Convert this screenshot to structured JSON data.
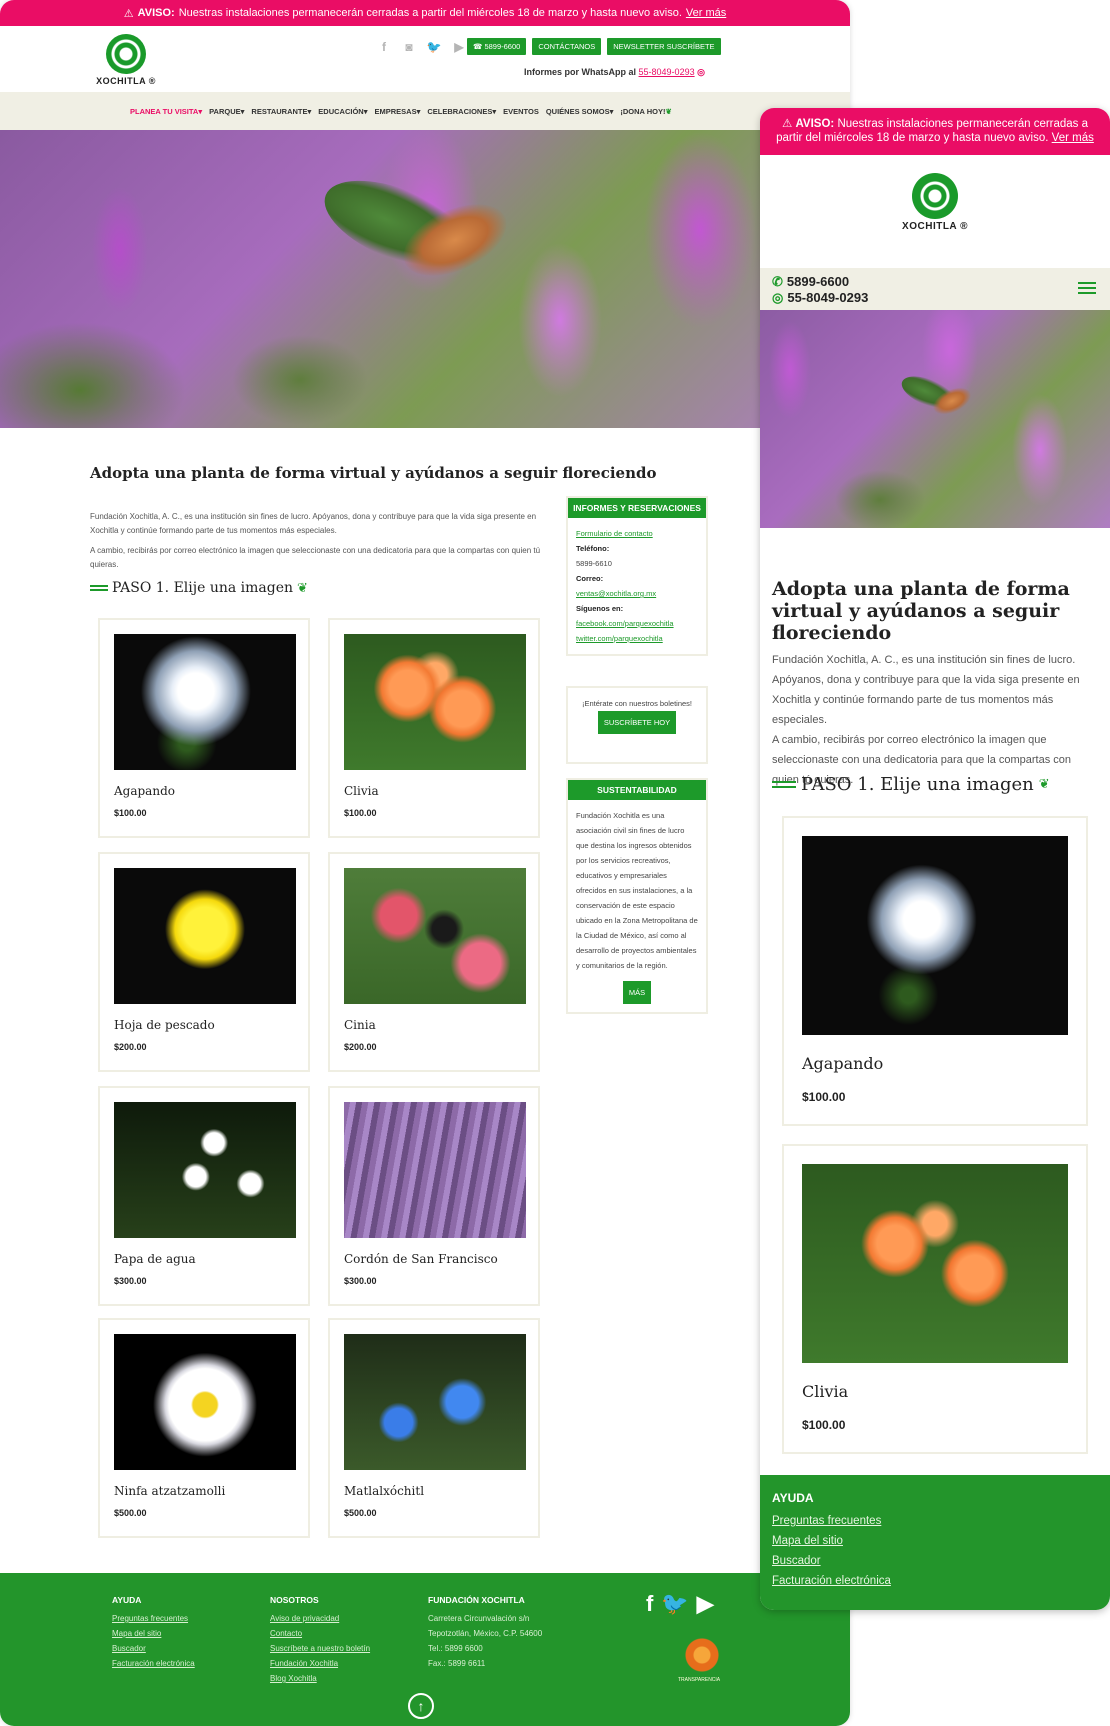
{
  "alert": {
    "label": "AVISO:",
    "text": "Nuestras instalaciones permanecerán cerradas a partir del miércoles 18 de marzo y hasta nuevo aviso.",
    "link": "Ver más"
  },
  "brand": {
    "name": "XOCHITLA",
    "reg": "®"
  },
  "header": {
    "phone_button": "5899-6600",
    "contact_button": "CONTÁCTANOS",
    "newsletter_button": "NEWSLETTER SUSCRÍBETE",
    "whatsapp_label": "Informes por WhatsApp al",
    "whatsapp_number": "55-8049-0293"
  },
  "nav": [
    "PLANEA TU VISITA",
    "PARQUE",
    "RESTAURANTE",
    "EDUCACIÓN",
    "EMPRESAS",
    "CELEBRACIONES",
    "EVENTOS",
    "QUIÉNES SOMOS",
    "¡DONA HOY!"
  ],
  "page": {
    "title": "Adopta una planta de forma virtual y ayúdanos a seguir floreciendo",
    "para1": "Fundación Xochitla, A. C., es una institución sin fines de lucro. Apóyanos, dona y contribuye para que la vida siga presente en Xochitla y continúe formando parte de tus momentos más especiales.",
    "para2": "A cambio, recibirás por correo electrónico la imagen que seleccionaste con una dedicatoria para que la compartas con quien tú quieras.",
    "step": "PASO 1. Elije una imagen"
  },
  "products": [
    {
      "name": "Agapando",
      "price": "$100.00"
    },
    {
      "name": "Clivia",
      "price": "$100.00"
    },
    {
      "name": "Hoja de pescado",
      "price": "$200.00"
    },
    {
      "name": "Cinia",
      "price": "$200.00"
    },
    {
      "name": "Papa de agua",
      "price": "$300.00"
    },
    {
      "name": "Cordón de San Francisco",
      "price": "$300.00"
    },
    {
      "name": "Ninfa atzatzamolli",
      "price": "$500.00"
    },
    {
      "name": "Matlalxóchitl",
      "price": "$500.00"
    }
  ],
  "sidebar": {
    "info_title": "INFORMES Y RESERVACIONES",
    "contact_form": "Formulario de contacto",
    "phone_label": "Teléfono:",
    "phone": "5899-6610",
    "email_label": "Correo:",
    "email": "ventas@xochitla.org.mx",
    "follow_label": "Síguenos en:",
    "facebook": "facebook.com/parquexochitla",
    "twitter": "twitter.com/parquexochitla",
    "newsletter_text": "¡Entérate con nuestros boletines!",
    "newsletter_button": "SUSCRÍBETE HOY",
    "sustain_title": "SUSTENTABILIDAD",
    "sustain_text": "Fundación Xochitla es una asociación civil sin fines de lucro que destina los ingresos obtenidos por los servicios recreativos, educativos y empresariales ofrecidos en sus instalaciones, a la conservación de este espacio ubicado en la Zona Metropolitana de la Ciudad de México, así como al desarrollo de proyectos ambientales y comunitarios de la región.",
    "more_button": "MÁS"
  },
  "footer": {
    "help_title": "AYUDA",
    "help_links": [
      "Preguntas frecuentes",
      "Mapa del sitio",
      "Buscador",
      "Facturación electrónica"
    ],
    "about_title": "NOSOTROS",
    "about_links": [
      "Aviso de privacidad",
      "Contacto",
      "Suscríbete a nuestro boletín",
      "Fundación Xochitla",
      "Blog Xochitla"
    ],
    "foundation_title": "FUNDACIÓN XOCHITLA",
    "address1": "Carretera Circunvalación s/n",
    "address2": "Tepotzotlán, México, C.P. 54600",
    "tel": "Tel.: 5899 6600",
    "fax": "Fax.: 5899 6611",
    "transparency": "TRANSPARENCIA"
  },
  "mobile": {
    "phone1": "5899-6600",
    "phone2": "55-8049-0293"
  },
  "colors": {
    "brand_green": "#1d9a2a",
    "alert_pink": "#ea0d65",
    "nav_bg": "#f0efe4"
  }
}
